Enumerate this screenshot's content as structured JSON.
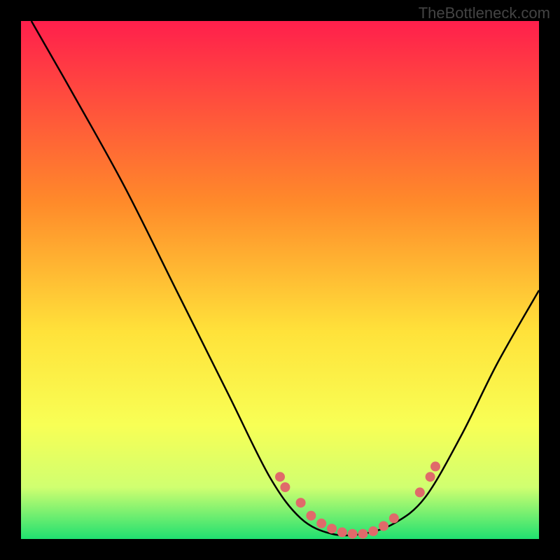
{
  "watermark": "TheBottleneck.com",
  "chart_data": {
    "type": "line",
    "title": "",
    "xlabel": "",
    "ylabel": "",
    "xlim": [
      0,
      100
    ],
    "ylim": [
      0,
      100
    ],
    "gradient_stops": [
      {
        "offset": 0,
        "color": "#ff1f4c"
      },
      {
        "offset": 35,
        "color": "#ff8a2a"
      },
      {
        "offset": 60,
        "color": "#ffe23a"
      },
      {
        "offset": 78,
        "color": "#f8ff55"
      },
      {
        "offset": 90,
        "color": "#d0ff70"
      },
      {
        "offset": 100,
        "color": "#20e070"
      }
    ],
    "curve": [
      {
        "x": 2,
        "y": 100
      },
      {
        "x": 10,
        "y": 86
      },
      {
        "x": 20,
        "y": 68
      },
      {
        "x": 30,
        "y": 48
      },
      {
        "x": 40,
        "y": 28
      },
      {
        "x": 48,
        "y": 12
      },
      {
        "x": 54,
        "y": 4
      },
      {
        "x": 60,
        "y": 1
      },
      {
        "x": 66,
        "y": 1
      },
      {
        "x": 72,
        "y": 3
      },
      {
        "x": 78,
        "y": 8
      },
      {
        "x": 85,
        "y": 20
      },
      {
        "x": 92,
        "y": 34
      },
      {
        "x": 100,
        "y": 48
      }
    ],
    "markers": [
      {
        "x": 50,
        "y": 12
      },
      {
        "x": 51,
        "y": 10
      },
      {
        "x": 54,
        "y": 7
      },
      {
        "x": 56,
        "y": 4.5
      },
      {
        "x": 58,
        "y": 3
      },
      {
        "x": 60,
        "y": 2
      },
      {
        "x": 62,
        "y": 1.3
      },
      {
        "x": 64,
        "y": 1
      },
      {
        "x": 66,
        "y": 1
      },
      {
        "x": 68,
        "y": 1.5
      },
      {
        "x": 70,
        "y": 2.5
      },
      {
        "x": 72,
        "y": 4
      },
      {
        "x": 77,
        "y": 9
      },
      {
        "x": 79,
        "y": 12
      },
      {
        "x": 80,
        "y": 14
      }
    ]
  }
}
